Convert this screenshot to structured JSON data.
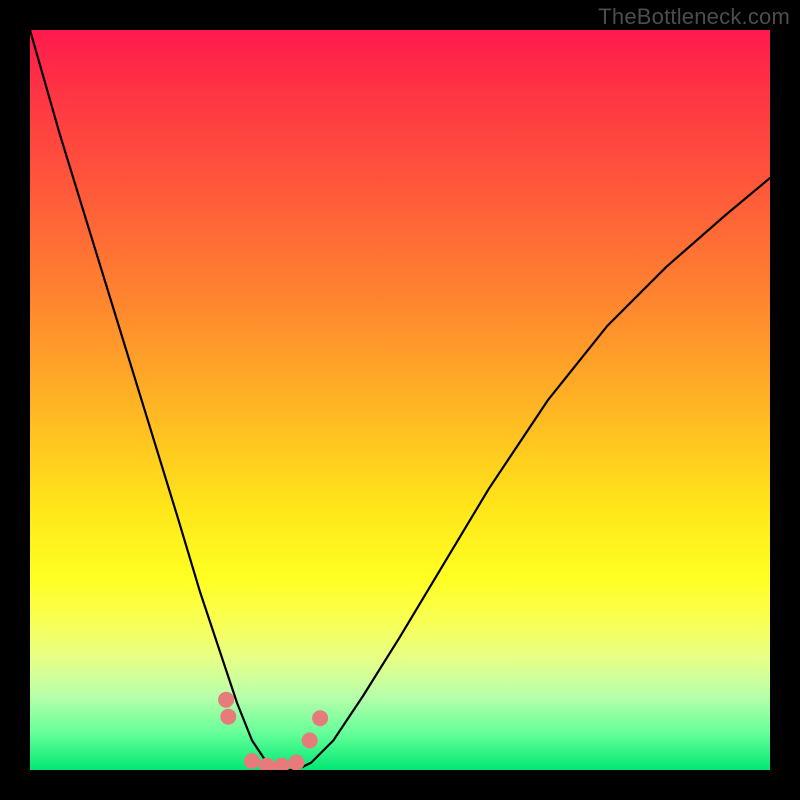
{
  "watermark": "TheBottleneck.com",
  "chart_data": {
    "type": "line",
    "title": "",
    "xlabel": "",
    "ylabel": "",
    "xlim": [
      0,
      100
    ],
    "ylim": [
      0,
      100
    ],
    "series": [
      {
        "name": "bottleneck-curve",
        "x": [
          0,
          4,
          8,
          12,
          16,
          20,
          23,
          26,
          28,
          30,
          32,
          34,
          36,
          38,
          41,
          45,
          50,
          56,
          62,
          70,
          78,
          86,
          94,
          100
        ],
        "y": [
          100,
          86,
          73,
          60,
          47,
          34,
          24,
          15,
          9,
          4,
          1,
          0,
          0,
          1,
          4,
          10,
          18,
          28,
          38,
          50,
          60,
          68,
          75,
          80
        ]
      },
      {
        "name": "dot-markers",
        "x": [
          26.5,
          26.8,
          30,
          32,
          34,
          36,
          37.8,
          39.2
        ],
        "y": [
          9.5,
          7.2,
          1.2,
          0.6,
          0.6,
          1.0,
          4.0,
          7.0
        ]
      }
    ],
    "colors": {
      "curve": "#000000",
      "markers": "#e77b7b",
      "gradient_top": "#ff1a4d",
      "gradient_mid": "#ffe41a",
      "gradient_bottom": "#00e874"
    }
  }
}
